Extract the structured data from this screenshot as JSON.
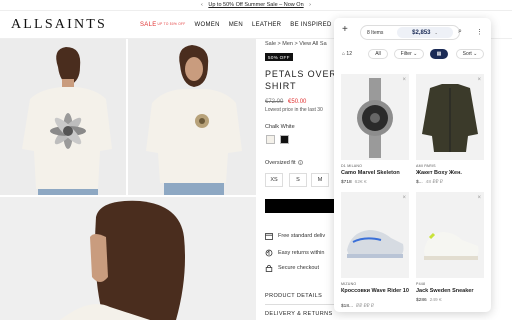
{
  "banner": {
    "text": "Up to 50% Off Summer Sale – Now On",
    "prev": "‹",
    "next": "›"
  },
  "header": {
    "logo": "ALLSAINTS",
    "nav": [
      {
        "label": "SALE",
        "tag": "UP TO 50% OFF"
      },
      {
        "label": "WOMEN"
      },
      {
        "label": "MEN"
      },
      {
        "label": "LEATHER"
      },
      {
        "label": "BE INSPIRED"
      }
    ]
  },
  "product": {
    "breadcrumb": "Sale > Men > View All Sa",
    "badge": "50% OFF",
    "title": "PETALS OVERS SHIRT",
    "price_old": "€72.00",
    "price_new": "€50.00",
    "lowest": "Lowest price in the last 30",
    "color_label": "Chalk White",
    "fit_label": "Oversized fit",
    "fit_info": "i",
    "sizes": [
      "XS",
      "S",
      "M"
    ],
    "features": [
      {
        "icon": "calendar-icon",
        "text": "Free standard deliv"
      },
      {
        "icon": "return-icon",
        "text": "Easy returns within"
      },
      {
        "icon": "lock-icon",
        "text": "Secure checkout"
      }
    ],
    "sections": [
      "PRODUCT DETAILS",
      "DELIVERY & RETURNS"
    ]
  },
  "panel": {
    "plus": "+",
    "items_count": "8 Items",
    "total": "$2,853",
    "total_chev": "⌄",
    "search_glyph": "⌕",
    "more_glyph": "⋮",
    "tag_count": "12",
    "filters": [
      "All",
      "Filter",
      "",
      "Sort"
    ],
    "cards": [
      {
        "brand": "D1 MILANO",
        "name": "Camo Marvel Skeleton",
        "price": "$718",
        "old": "62€ €",
        "image": "watch"
      },
      {
        "brand": "AMI PARIS",
        "name": "Жакет Boxy Жен.",
        "price": "$...",
        "old": "48 ₽₽ ₽",
        "image": "jacket"
      },
      {
        "brand": "MIZUNO",
        "name": "Кроссовки Wave Rider 10",
        "price": "$18...",
        "old": "₽₽ ₽₽ ₽",
        "image": "sneaker-blue"
      },
      {
        "brand": "P448",
        "name": "Jack Sweden Sneaker",
        "price": "$286",
        "old": "249 €",
        "image": "sneaker-white"
      }
    ]
  }
}
